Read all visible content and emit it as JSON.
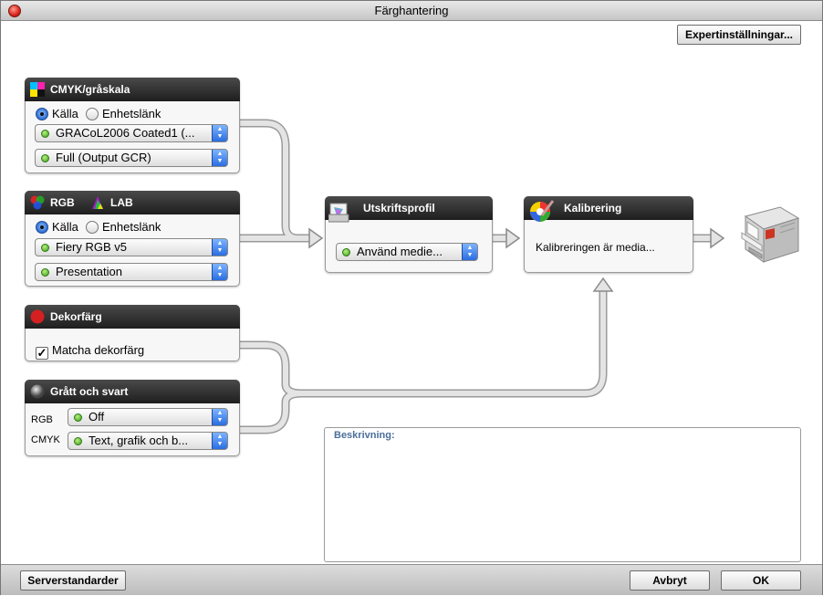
{
  "window": {
    "title": "Färghantering"
  },
  "toolbar": {
    "expert_label": "Expertinställningar..."
  },
  "cmyk_panel": {
    "title": "CMYK/gråskala",
    "radio_source": "Källa",
    "radio_device_link": "Enhetslänk",
    "profile_select": "GRACoL2006 Coated1 (...",
    "render_select": "Full (Output GCR)"
  },
  "rgb_panel": {
    "title_rgb": "RGB",
    "title_lab": "LAB",
    "radio_source": "Källa",
    "radio_device_link": "Enhetslänk",
    "profile_select": "Fiery RGB v5",
    "render_select": "Presentation"
  },
  "spot_panel": {
    "title": "Dekorfärg",
    "checkbox_label": "Matcha dekorfärg",
    "checkbox_checked": true
  },
  "gray_panel": {
    "title": "Grått och svart",
    "rgb_label": "RGB",
    "rgb_select": "Off",
    "cmyk_label": "CMYK",
    "cmyk_select": "Text, grafik och b..."
  },
  "output_panel": {
    "title": "Utskriftsprofil",
    "select": "Använd medie..."
  },
  "calibration_panel": {
    "title": "Kalibrering",
    "text": "Kalibreringen är media..."
  },
  "description": {
    "title": "Beskrivning:"
  },
  "footer": {
    "server_defaults_label": "Serverstandarder",
    "cancel_label": "Avbryt",
    "ok_label": "OK"
  },
  "icons": {
    "close": "close-icon",
    "cmyk": "cmyk-swatch-icon",
    "rgb": "rgb-circles-icon",
    "lab": "lab-triangle-icon",
    "spot": "red-dot-icon",
    "gray": "gray-dot-icon",
    "output": "printer-profile-icon",
    "calibration": "color-wheel-icon",
    "printer": "printer-icon",
    "select_arrows": "select-arrows-icon"
  },
  "colors": {
    "header_bg": "#2b2b2b",
    "select_accent": "#2a6de0",
    "status_ok": "#3b9a1c",
    "description_title": "#4b6e9a",
    "flow_arrow": "#dcdcdc"
  }
}
